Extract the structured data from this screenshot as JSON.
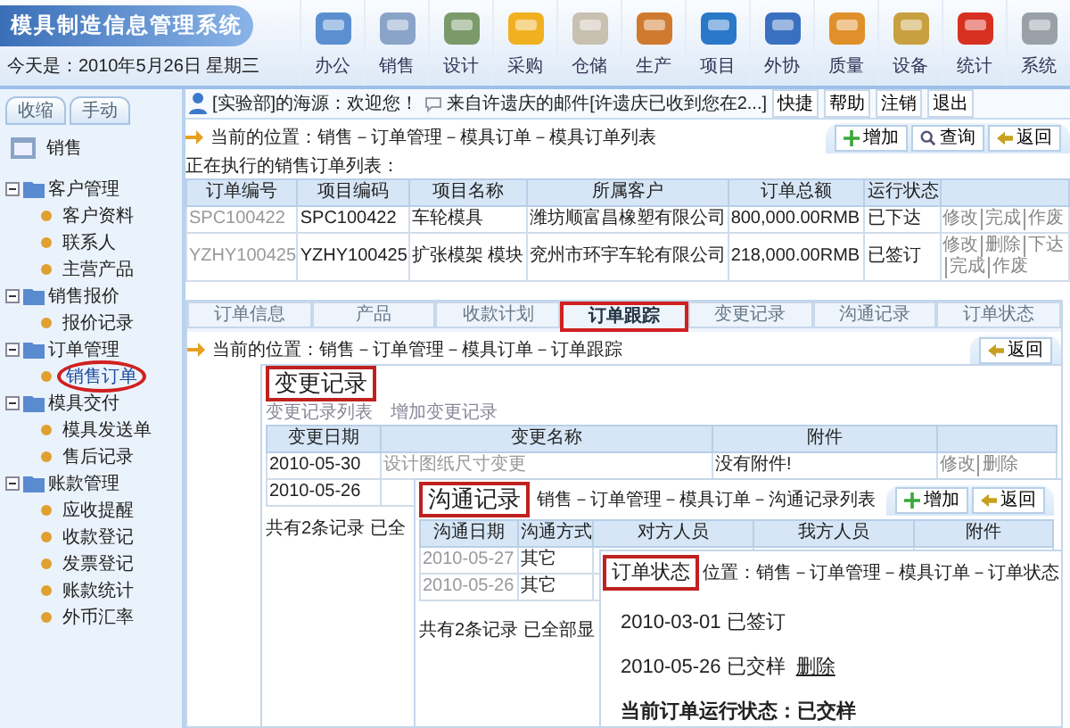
{
  "header": {
    "title": "模具制造信息管理系统",
    "date": "今天是：2010年5月26日 星期三",
    "toolbar": [
      "办公",
      "销售",
      "设计",
      "采购",
      "仓储",
      "生产",
      "项目",
      "外协",
      "质量",
      "设备",
      "统计",
      "系统"
    ]
  },
  "sidebar": {
    "tabs": [
      "收缩",
      "手动"
    ],
    "section": "销售",
    "groups": [
      {
        "label": "客户管理",
        "expanded": true,
        "children": [
          {
            "label": "客户资料",
            "selected": false
          },
          {
            "label": "联系人",
            "selected": false
          },
          {
            "label": "主营产品",
            "selected": false
          }
        ]
      },
      {
        "label": "销售报价",
        "expanded": true,
        "children": [
          {
            "label": "报价记录",
            "selected": false
          }
        ]
      },
      {
        "label": "订单管理",
        "expanded": true,
        "children": [
          {
            "label": "销售订单",
            "selected": true
          }
        ]
      },
      {
        "label": "模具交付",
        "expanded": true,
        "children": [
          {
            "label": "模具发送单",
            "selected": false
          },
          {
            "label": "售后记录",
            "selected": false
          }
        ]
      },
      {
        "label": "账款管理",
        "expanded": true,
        "children": [
          {
            "label": "应收提醒",
            "selected": false
          },
          {
            "label": "收款登记",
            "selected": false
          },
          {
            "label": "发票登记",
            "selected": false
          },
          {
            "label": "账款统计",
            "selected": false
          },
          {
            "label": "外币汇率",
            "selected": false
          }
        ]
      }
    ]
  },
  "notice": {
    "welcome": "[实验部]的海源：欢迎您！",
    "mail": "来自许遗庆的邮件[许遗庆已收到您在2...]",
    "buttons": [
      "快捷",
      "帮助",
      "注销",
      "退出"
    ]
  },
  "order_list": {
    "breadcrumb": "当前的位置：销售－订单管理－模具订单－模具订单列表",
    "buttons": [
      {
        "label": "增加",
        "kind": "add"
      },
      {
        "label": "查询",
        "kind": "search"
      },
      {
        "label": "返回",
        "kind": "back"
      }
    ],
    "caption": "正在执行的销售订单列表：",
    "columns": [
      "订单编号",
      "项目编码",
      "项目名称",
      "所属客户",
      "订单总额",
      "运行状态"
    ],
    "rows": [
      {
        "cells": [
          "SPC100422",
          "SPC100422",
          "车轮模具",
          "潍坊顺富昌橡塑有限公司",
          "800,000.00RMB",
          "已下达"
        ],
        "actions": [
          "修改",
          "完成",
          "作废"
        ]
      },
      {
        "cells": [
          "YZHY100425",
          "YZHY100425",
          "扩张模架 模块",
          "兖州市环宇车轮有限公司",
          "218,000.00RMB",
          "已签订"
        ],
        "actions": [
          "修改",
          "删除",
          "下达",
          "完成",
          "作废"
        ]
      }
    ]
  },
  "order_detail": {
    "tabs": [
      {
        "label": "订单信息",
        "selected": false
      },
      {
        "label": "产品",
        "selected": false
      },
      {
        "label": "收款计划",
        "selected": false
      },
      {
        "label": "订单跟踪",
        "selected": true
      },
      {
        "label": "变更记录",
        "selected": false
      },
      {
        "label": "沟通记录",
        "selected": false
      },
      {
        "label": "订单状态",
        "selected": false
      }
    ],
    "breadcrumb": "当前的位置：销售－订单管理－模具订单－订单跟踪",
    "buttons": [
      {
        "label": "返回",
        "kind": "back"
      }
    ]
  },
  "change_log": {
    "title": "变更记录",
    "links": [
      "变更记录列表",
      "增加变更记录"
    ],
    "columns": [
      "变更日期",
      "变更名称",
      "附件"
    ],
    "rows": [
      {
        "cells": [
          "2010-05-30",
          "设计图纸尺寸变更",
          "没有附件!"
        ],
        "actions": [
          "修改",
          "删除"
        ]
      },
      {
        "cells": [
          "2010-05-26"
        ]
      }
    ],
    "footer": "共有2条记录 已全"
  },
  "communication_log": {
    "title": "沟通记录",
    "breadcrumb": "销售－订单管理－模具订单－沟通记录列表",
    "buttons": [
      {
        "label": "增加",
        "kind": "add"
      },
      {
        "label": "返回",
        "kind": "back"
      }
    ],
    "columns": [
      "沟通日期",
      "沟通方式",
      "对方人员",
      "我方人员",
      "附件"
    ],
    "rows": [
      {
        "cells": [
          "2010-05-27",
          "其它"
        ]
      },
      {
        "cells": [
          "2010-05-26",
          "其它"
        ]
      }
    ],
    "footer": "共有2条记录 已全部显"
  },
  "order_status": {
    "title": "订单状态",
    "breadcrumb": "位置：销售－订单管理－模具订单－订单状态",
    "entries": [
      {
        "date": "2010-03-01",
        "status": "已签订"
      },
      {
        "date": "2010-05-26",
        "status": "已交样",
        "link": "删除"
      }
    ],
    "current": "当前订单运行状态：已交样"
  }
}
